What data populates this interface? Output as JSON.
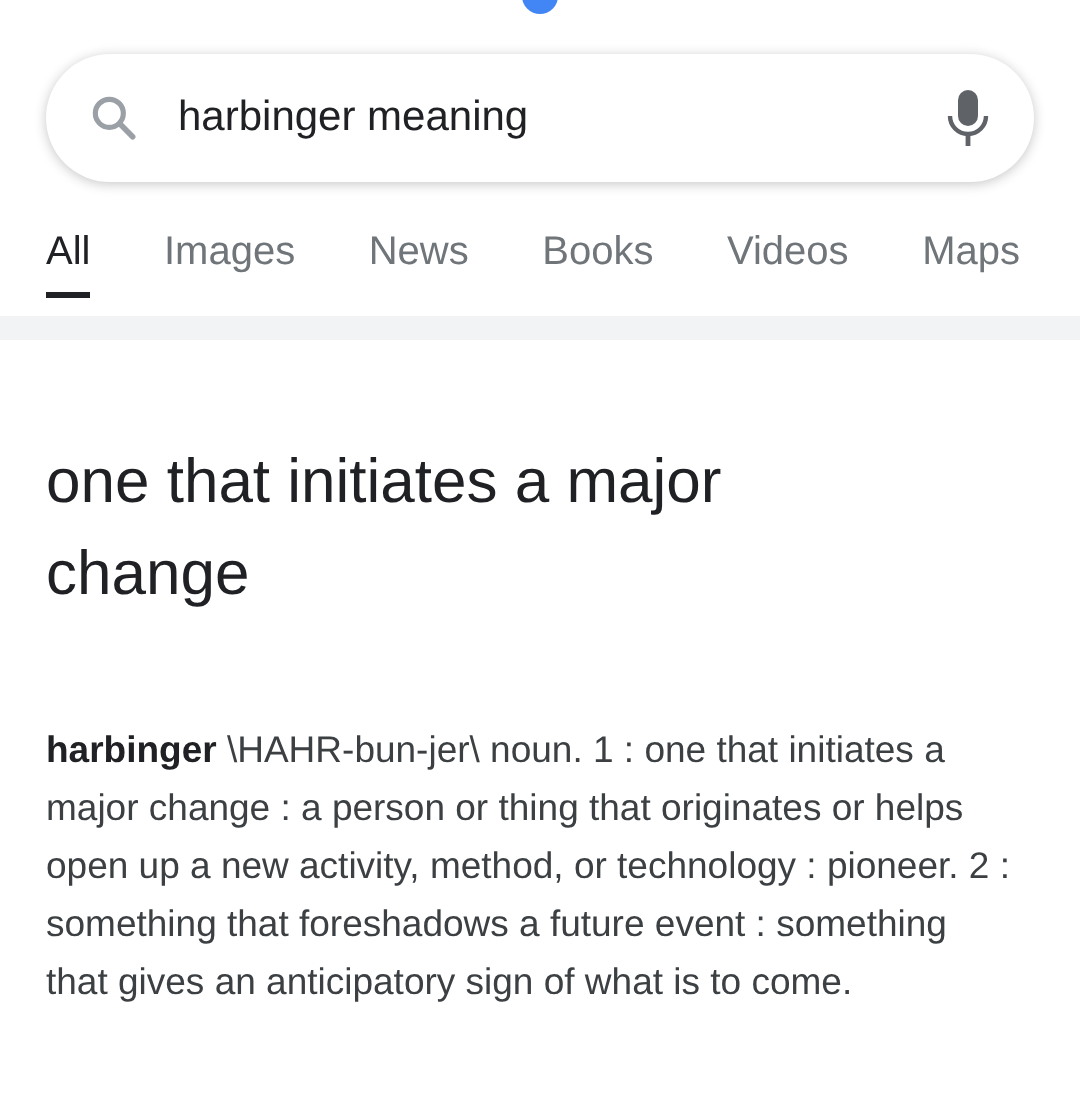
{
  "search": {
    "value": "harbinger meaning"
  },
  "tabs": [
    {
      "label": "All",
      "selected": true
    },
    {
      "label": "Images",
      "selected": false
    },
    {
      "label": "News",
      "selected": false
    },
    {
      "label": "Books",
      "selected": false
    },
    {
      "label": "Videos",
      "selected": false
    },
    {
      "label": "Maps",
      "selected": false
    }
  ],
  "result": {
    "heading": "one that initiates a major change",
    "definition": "**harbinger** \\HAHR-bun-jer\\ noun. 1 : one that initiates a major change : a person or thing that originates or helps open up a new activity, method, or technology : pioneer. 2 : something that foreshadows a future event : something that gives an anticipatory sign of what is to come."
  }
}
